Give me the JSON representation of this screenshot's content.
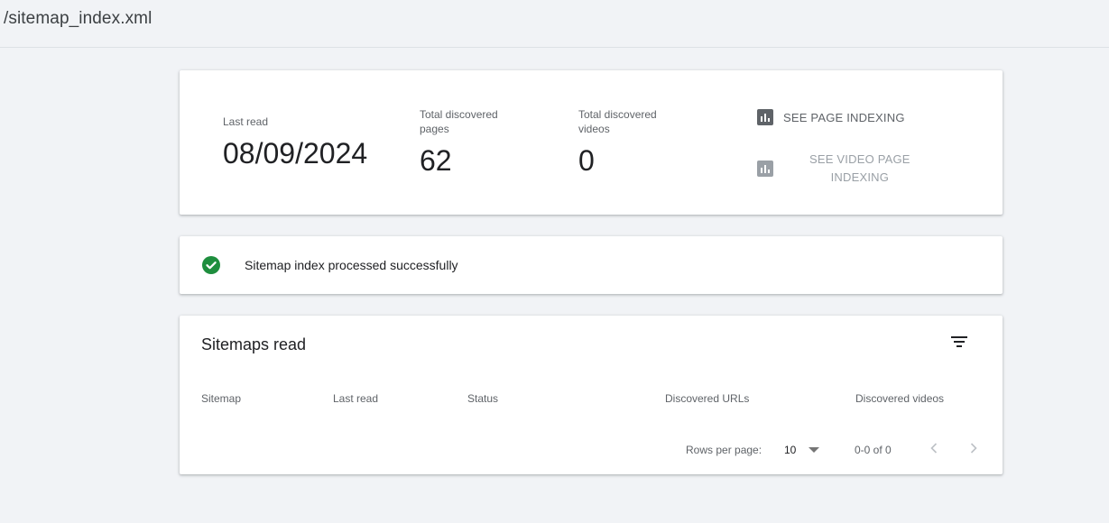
{
  "header": {
    "title": "/sitemap_index.xml"
  },
  "summary": {
    "last_read_label": "Last read",
    "last_read_value": "08/09/2024",
    "pages_label_line1": "Total discovered",
    "pages_label_line2": "pages",
    "pages_value": "62",
    "videos_label_line1": "Total discovered",
    "videos_label_line2": "videos",
    "videos_value": "0",
    "see_page_indexing": "SEE PAGE INDEXING",
    "see_video_line1": "SEE VIDEO PAGE",
    "see_video_line2": "INDEXING",
    "icon": "bar-chart-icon"
  },
  "status": {
    "icon": "check-circle-icon",
    "text": "Sitemap index processed successfully",
    "color": "#1e8e3e"
  },
  "sitemaps_table": {
    "title": "Sitemaps read",
    "filter_icon": "filter-icon",
    "columns": [
      "Sitemap",
      "Last read",
      "Status",
      "Discovered URLs",
      "Discovered videos"
    ],
    "rows": [],
    "footer": {
      "rows_per_page_label": "Rows per page:",
      "rows_per_page_value": "10",
      "range_text": "0-0 of 0"
    }
  },
  "colors": {
    "background": "#f1f3f6",
    "card": "#ffffff",
    "icon_active": "#5f6368",
    "icon_disabled": "#9aa0a6",
    "success": "#1e8e3e"
  }
}
